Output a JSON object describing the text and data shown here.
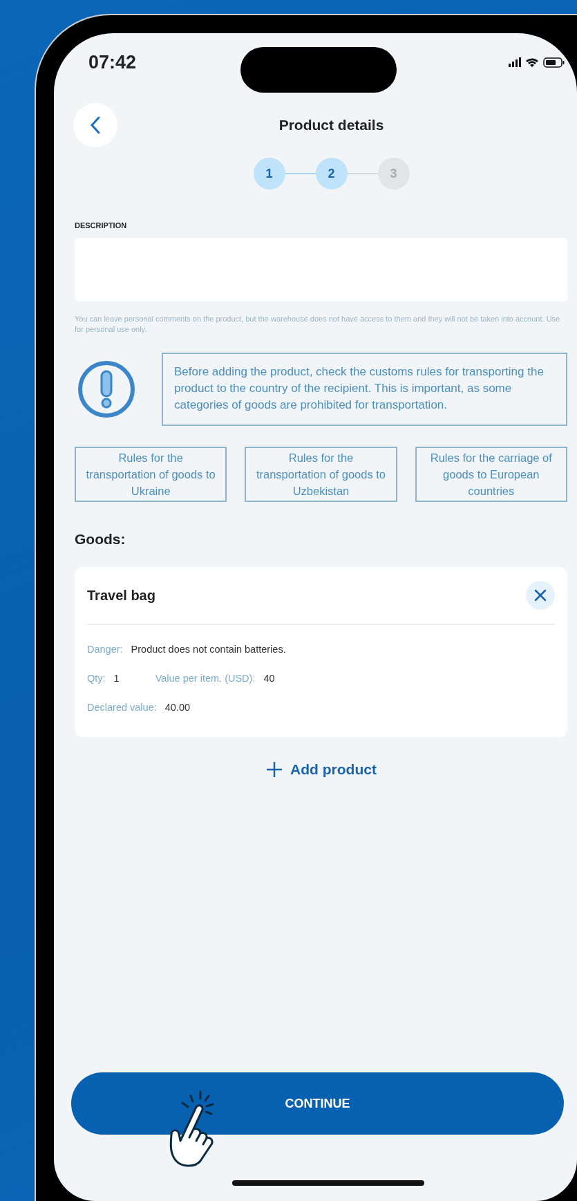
{
  "status_bar": {
    "time": "07:42"
  },
  "header": {
    "title": "Product details"
  },
  "stepper": [
    {
      "label": "1",
      "reached": true
    },
    {
      "label": "2",
      "reached": true
    },
    {
      "label": "3",
      "reached": false
    }
  ],
  "description": {
    "label": "DESCRIPTION",
    "hint": "You can leave personal comments on the product, but the warehouse does not have access to them and they will not be taken into account. Use for personal use only."
  },
  "notice": "Before adding the product, check the customs rules for transporting the product to the country of the recipient. This is important, as some categories of goods are prohibited for transportation.",
  "rule_links": [
    "Rules for the transportation of goods to Ukraine",
    "Rules for the transportation of goods to Uzbekistan",
    "Rules for the carriage of goods to European countries"
  ],
  "goods": {
    "heading": "Goods:",
    "items": [
      {
        "name": "Travel bag",
        "rows": [
          [
            {
              "label": "Danger:",
              "value": "Product does not contain batteries."
            }
          ],
          [
            {
              "label": "Qty:",
              "value": "1"
            },
            {
              "label": "Value per item. (USD):",
              "value": "40"
            }
          ],
          [
            {
              "label": "Declared value:",
              "value": "40.00"
            }
          ]
        ]
      }
    ]
  },
  "add_button": "Add product",
  "continue_button": "CONTINUE"
}
